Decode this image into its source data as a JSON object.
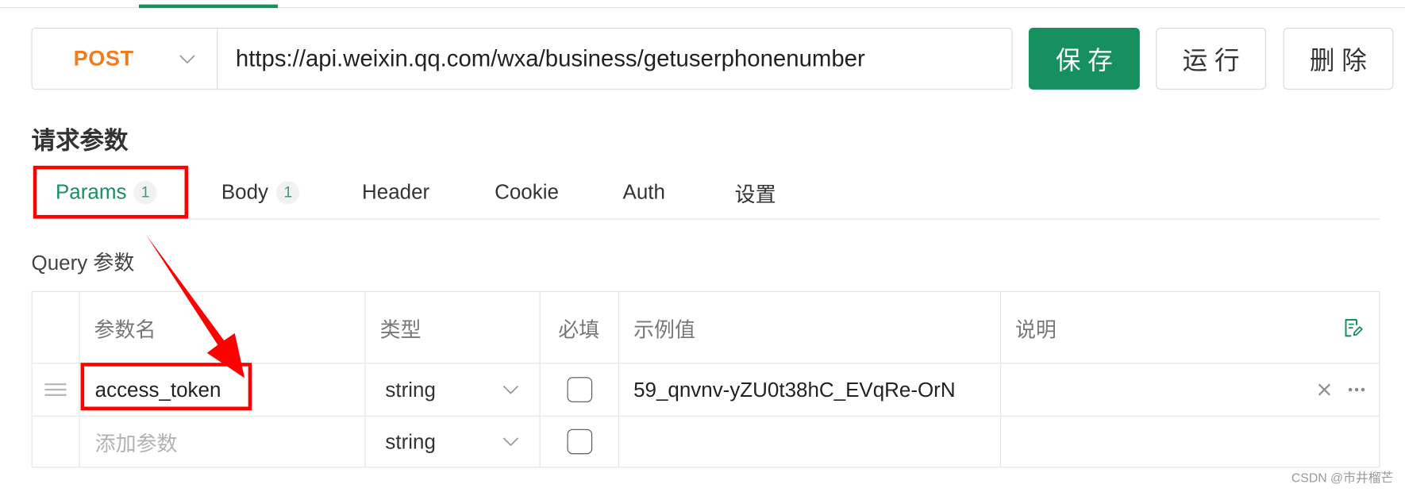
{
  "colors": {
    "accent": "#17905f",
    "method": "#f07c1c",
    "annotation": "#ff0000",
    "badge_text": "#3f9b76"
  },
  "request": {
    "method": "POST",
    "url": "https://api.weixin.qq.com/wxa/business/getuserphonenumber"
  },
  "actions": {
    "save": "保 存",
    "run": "运 行",
    "delete": "删 除"
  },
  "section_title": "请求参数",
  "tabs": [
    {
      "label": "Params",
      "badge": "1",
      "active": true
    },
    {
      "label": "Body",
      "badge": "1",
      "active": false
    },
    {
      "label": "Header",
      "active": false
    },
    {
      "label": "Cookie",
      "active": false
    },
    {
      "label": "Auth",
      "active": false
    },
    {
      "label": "设置",
      "active": false
    }
  ],
  "query_label": "Query 参数",
  "table": {
    "headers": {
      "name": "参数名",
      "type": "类型",
      "required": "必填",
      "example": "示例值",
      "description": "说明"
    },
    "rows": [
      {
        "name": "access_token",
        "type": "string",
        "required": false,
        "example": "59_qnvnv-yZU0t38hC_EVqRe-OrN",
        "description": ""
      }
    ],
    "new_row": {
      "name_placeholder": "添加参数",
      "type": "string",
      "required": false
    }
  },
  "icons": {
    "method_dropdown": "chevron-down-icon",
    "type_dropdown": "chevron-down-icon",
    "row_drag": "drag-handle-icon",
    "bulk_edit": "edit-document-icon",
    "row_delete": "close-icon",
    "row_more": "more-icon"
  },
  "watermark": "CSDN @市井榴芒"
}
